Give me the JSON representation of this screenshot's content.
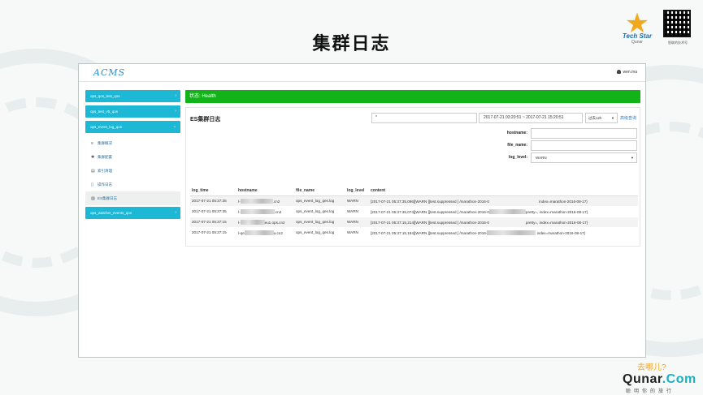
{
  "slide": {
    "title": "集群日志",
    "brand": {
      "tech_star_line1": "Tech Star",
      "tech_star_line2": "Qunar",
      "qr_caption": "智联的技术号"
    },
    "footer": {
      "cn_slogan": "去哪儿?",
      "brand_prefix": "Qunar",
      "brand_suffix": ".Com",
      "tagline": "聪明你的旅行"
    }
  },
  "app": {
    "logo_text": "ACMS",
    "user": "wen.ma",
    "sidebar": {
      "groups_top": [
        {
          "label": "ops_qos_test_qos"
        },
        {
          "label": "ops_test_v5_qos"
        },
        {
          "label": "ops_event_log_qos"
        }
      ],
      "sub_items": [
        {
          "icon": "list-icon",
          "glyph": "≡",
          "label": "集群概况"
        },
        {
          "icon": "gear-icon",
          "glyph": "✱",
          "label": "集群配置"
        },
        {
          "icon": "document-icon",
          "glyph": "▤",
          "label": "索引清理"
        },
        {
          "icon": "file-icon",
          "glyph": "▯",
          "label": "操作日志"
        },
        {
          "icon": "image-icon",
          "glyph": "▨",
          "label": "ES集群日志"
        }
      ],
      "groups_bottom": [
        {
          "label": "ops_watcher_events_qos"
        }
      ]
    },
    "status": {
      "label": "状态: Health"
    },
    "panel": {
      "title": "ES集群日志",
      "query_value": "*",
      "time_range": "2017-07-21 03:20:51 ~ 2017-07-21 15:20:51",
      "range_select": "过去12h",
      "advanced_link": "高级查询",
      "filters": {
        "hostname_label": "hostname:",
        "hostname_value": "",
        "file_name_label": "file_name:",
        "file_name_value": "",
        "log_level_label": "log_level:",
        "log_level_value": "WARN"
      },
      "table": {
        "columns": [
          "log_time",
          "hostname",
          "file_name",
          "log_level",
          "content"
        ],
        "rows": [
          {
            "log_time": "2017-07-21 05:37:35",
            "host_pre": "l-",
            "host_suf": ".cn2",
            "file_name": "ops_event_log_qes.log",
            "log_level": "WARN",
            "content_pre": "[2017-07-21 05:37:35,096][WARN ][test.suppressed ] /marathon-2016-0",
            "content_suf": " index=marathon-2016-08-17}"
          },
          {
            "log_time": "2017-07-21 05:37:35",
            "host_pre": "l-",
            "host_suf": ".cn2",
            "file_name": "ops_event_log_qes.log",
            "log_level": "WARN",
            "content_pre": "[2017-07-21 05:37:35,074][WARN ][test.suppressed ] /marathon-2016-0",
            "content_suf": "pretty=, index=marathon-2016-08-17}"
          },
          {
            "log_time": "2017-07-21 05:37:15",
            "host_pre": "l-",
            "host_suf": "eu1.ops.cn2",
            "file_name": "ops_event_log_qes.log",
            "log_level": "WARN",
            "content_pre": "[2017-07-21 05:37:15,214][WARN ][test.suppressed ] /marathon-2016-0",
            "content_suf": "pretty=, index=marathon-2016-08-17}"
          },
          {
            "log_time": "2017-07-21 05:37:15",
            "host_pre": "l-qe",
            "host_suf": "u.cn2",
            "file_name": "ops_event_log_qes.log",
            "log_level": "WARN",
            "content_pre": "[2017-07-21 05:37:15,194][WARN ][test.suppressed ] /marathon-2016-",
            "content_suf": " index=marathon-2016-08-17}"
          }
        ]
      }
    }
  },
  "colors": {
    "sidebar_accent": "#1cb8d6",
    "status_green": "#12b318",
    "link_blue": "#2a7fc8"
  }
}
